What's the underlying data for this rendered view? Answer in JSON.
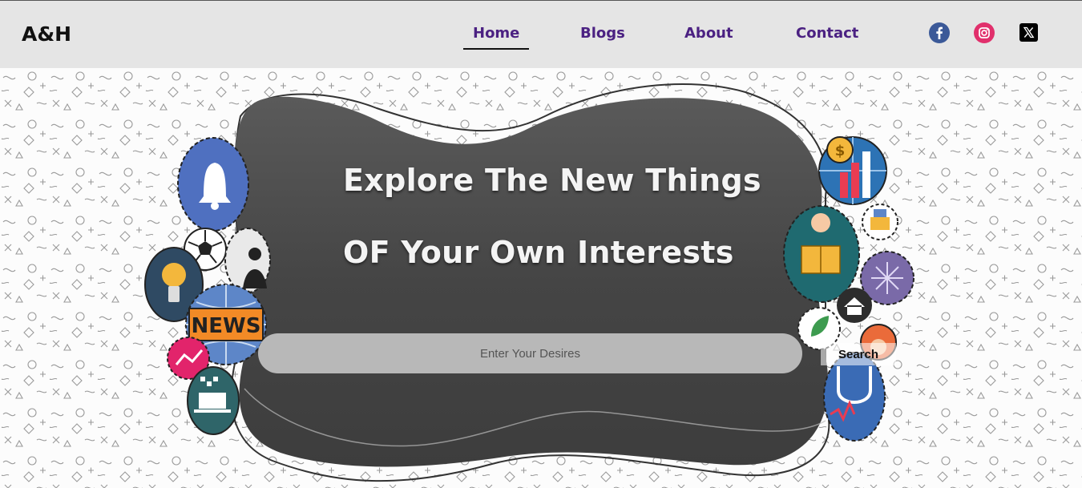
{
  "brand": {
    "logo": "A&H"
  },
  "nav": {
    "items": [
      {
        "label": "Home",
        "active": true
      },
      {
        "label": "Blogs",
        "active": false
      },
      {
        "label": "About",
        "active": false
      },
      {
        "label": "Contact",
        "active": false
      }
    ],
    "link_color": "#4b2182"
  },
  "social": [
    {
      "icon": "facebook-icon",
      "color": "#3b5998"
    },
    {
      "icon": "instagram-icon",
      "color": "#e1306c"
    },
    {
      "icon": "x-twitter-icon",
      "color": "#000000"
    }
  ],
  "hero": {
    "headline_line1": "Explore The New Things",
    "headline_line2": "OF Your Own Interests",
    "search": {
      "placeholder": "Enter Your Desires",
      "value": "",
      "button_label": "Search"
    }
  },
  "decor_icons": [
    "bell-icon",
    "soccer-ball-icon",
    "lightbulb-icon",
    "news-globe-icon",
    "engineer-icon",
    "laptop-icon",
    "coin-chart-globe-icon",
    "reader-icon",
    "brain-chip-icon",
    "house-icon",
    "leaf-icon",
    "stethoscope-icon"
  ],
  "colors": {
    "header_bg": "#e5e5e5",
    "blob": "#4a4a4a",
    "search_bg": "#b8b8b8"
  }
}
